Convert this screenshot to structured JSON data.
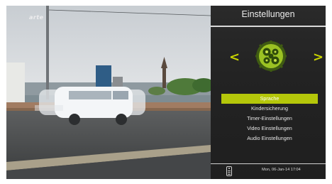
{
  "video": {
    "channel_logo": "arte"
  },
  "panel": {
    "title": "Einstellungen",
    "arrow_left": "<",
    "arrow_right": ">",
    "current_icon": "gear-icon",
    "items": [
      {
        "label": "Sprache",
        "selected": true
      },
      {
        "label": "Kindersicherung",
        "selected": false
      },
      {
        "label": "Timer-Einstellungen",
        "selected": false
      },
      {
        "label": "Video Einstellungen",
        "selected": false
      },
      {
        "label": "Audio Einstellungen",
        "selected": false
      }
    ],
    "footer": {
      "remote_icon": "remote-control-icon",
      "datetime": "Mon, 06-Jan-14  17:04"
    }
  },
  "colors": {
    "accent": "#b5c70a",
    "arrow": "#c9d400",
    "panel_bg": "#232323"
  }
}
